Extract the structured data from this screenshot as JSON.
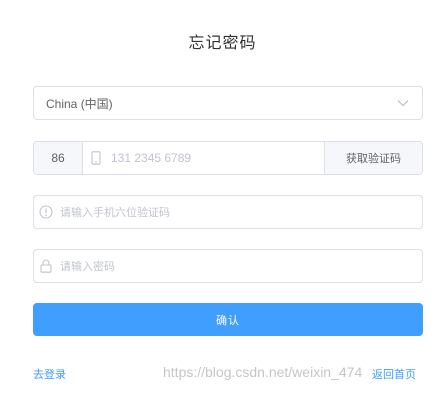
{
  "page": {
    "title": "忘记密码"
  },
  "country_select": {
    "value": "China (中国)",
    "icon": "chevron-down-icon"
  },
  "phone": {
    "prefix": "86",
    "icon": "mobile-phone-icon",
    "placeholder": "131 2345 6789",
    "get_code_label": "获取验证码"
  },
  "sms_code": {
    "icon": "info-circle-icon",
    "placeholder": "请输入手机六位验证码"
  },
  "password": {
    "icon": "lock-icon",
    "placeholder": "请输入密码"
  },
  "confirm_button": {
    "label": "确认"
  },
  "links": {
    "login": "去登录",
    "home": "返回首页"
  },
  "watermark": "https://blog.csdn.net/weixin_4​​​​​​​​​​​​​​​​​​​​​​74",
  "colors": {
    "primary": "#409eff",
    "border": "#dcdfe6",
    "placeholder": "#c0c4cc",
    "addon_bg": "#f5f7fa"
  }
}
